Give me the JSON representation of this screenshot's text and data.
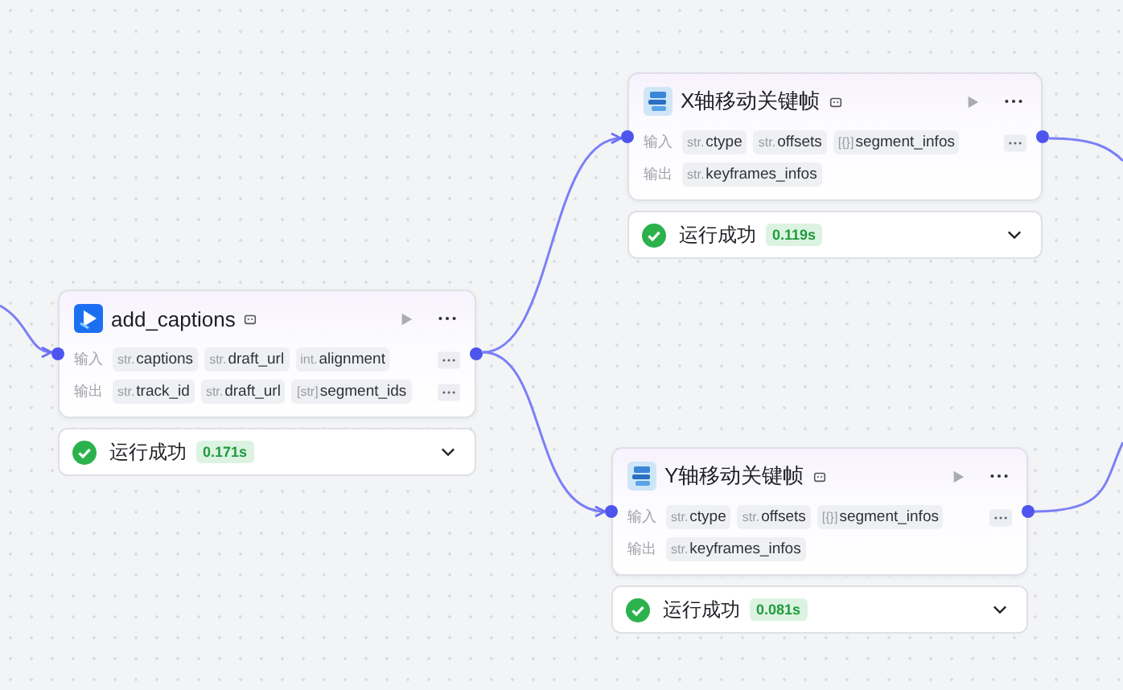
{
  "nodes": [
    {
      "kind": "plugin",
      "title": "add_captions",
      "inputs": [
        {
          "type": "str.",
          "name": "captions"
        },
        {
          "type": "str.",
          "name": "draft_url"
        },
        {
          "type": "int.",
          "name": "alignment"
        }
      ],
      "outputs": [
        {
          "type": "str.",
          "name": "track_id"
        },
        {
          "type": "str.",
          "name": "draft_url"
        },
        {
          "type": "[str]",
          "name": "segment_ids"
        }
      ],
      "input_label": "输入",
      "output_label": "输出",
      "status": "运行成功",
      "time": "0.171s",
      "success": true
    },
    {
      "kind": "workflow",
      "title": "X轴移动关键帧",
      "inputs": [
        {
          "type": "str.",
          "name": "ctype"
        },
        {
          "type": "str.",
          "name": "offsets"
        },
        {
          "type": "[{}]",
          "name": "segment_infos"
        }
      ],
      "outputs": [
        {
          "type": "str.",
          "name": "keyframes_infos"
        }
      ],
      "input_label": "输入",
      "output_label": "输出",
      "status": "运行成功",
      "time": "0.119s",
      "success": true
    },
    {
      "kind": "workflow",
      "title": "Y轴移动关键帧",
      "inputs": [
        {
          "type": "str.",
          "name": "ctype"
        },
        {
          "type": "str.",
          "name": "offsets"
        },
        {
          "type": "[{}]",
          "name": "segment_infos"
        }
      ],
      "outputs": [
        {
          "type": "str.",
          "name": "keyframes_infos"
        }
      ],
      "input_label": "输入",
      "output_label": "输出",
      "status": "运行成功",
      "time": "0.081s",
      "success": true
    }
  ]
}
